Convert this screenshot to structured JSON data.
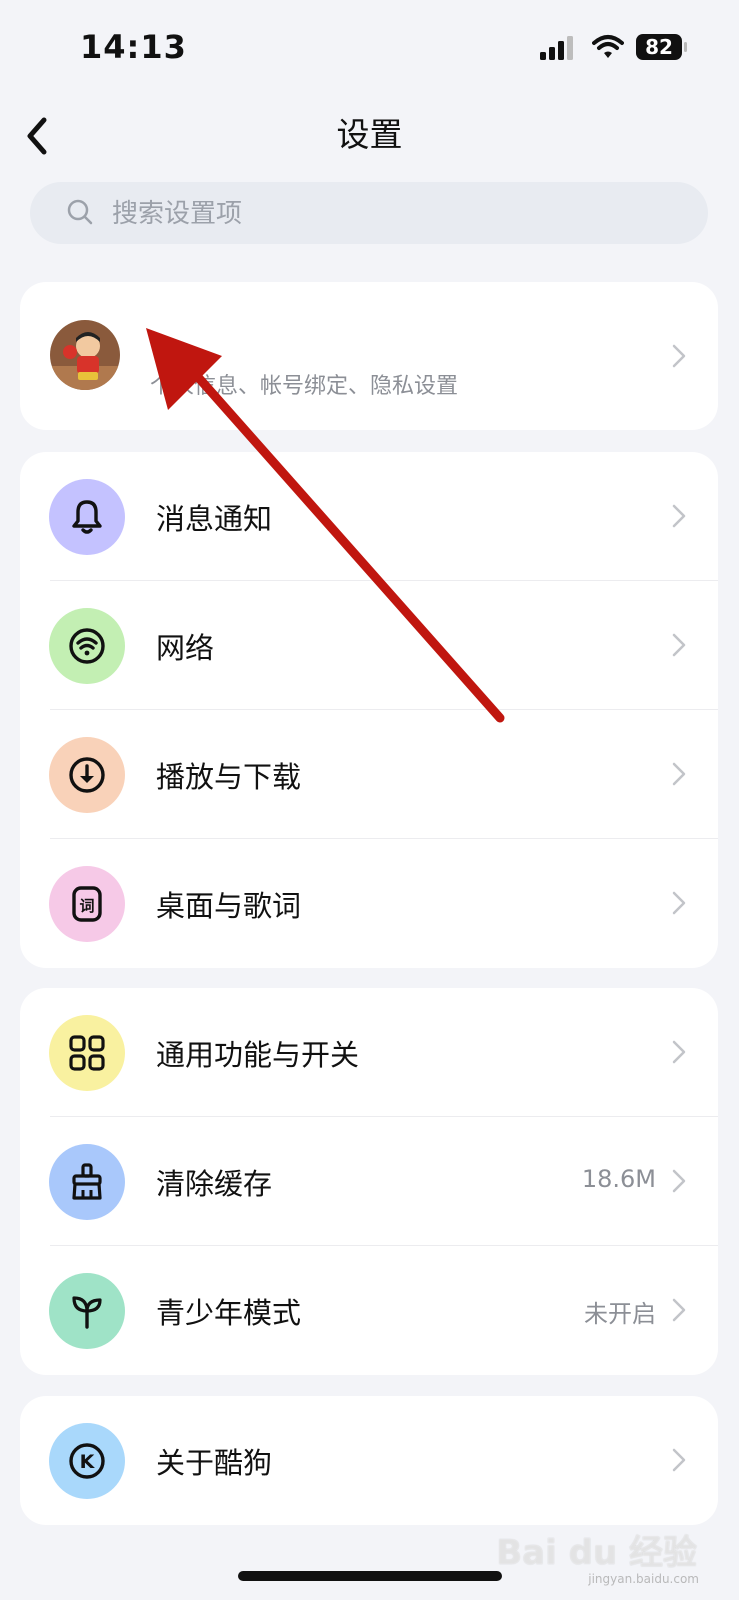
{
  "status_bar": {
    "time": "14:13",
    "battery": "82"
  },
  "nav": {
    "title": "设置"
  },
  "search": {
    "placeholder": "搜索设置项"
  },
  "profile": {
    "subtitle": "个人信息、帐号绑定、隐私设置"
  },
  "groups": [
    {
      "items": [
        {
          "label": "消息通知",
          "icon": "bell-icon",
          "color": "#c4c2ff"
        },
        {
          "label": "网络",
          "icon": "wifi-icon",
          "color": "#c3efb3"
        },
        {
          "label": "播放与下载",
          "icon": "download-icon",
          "color": "#f9d2b9"
        },
        {
          "label": "桌面与歌词",
          "icon": "lyrics-icon",
          "color": "#f6c9e7"
        }
      ]
    },
    {
      "items": [
        {
          "label": "通用功能与开关",
          "icon": "grid-icon",
          "color": "#f9f1a0"
        },
        {
          "label": "清除缓存",
          "icon": "broom-icon",
          "color": "#a9c8fb",
          "value": "18.6M"
        },
        {
          "label": "青少年模式",
          "icon": "sprout-icon",
          "color": "#9fe3c7",
          "value": "未开启"
        }
      ]
    },
    {
      "items": [
        {
          "label": "关于酷狗",
          "icon": "kugou-icon",
          "color": "#a9d8fb"
        }
      ]
    }
  ],
  "watermark": {
    "text": "Bai du 经验",
    "sub": "jingyan.baidu.com"
  },
  "colors": {
    "background": "#f3f4f8",
    "card": "#ffffff",
    "annotation_arrow": "#c0160f"
  }
}
